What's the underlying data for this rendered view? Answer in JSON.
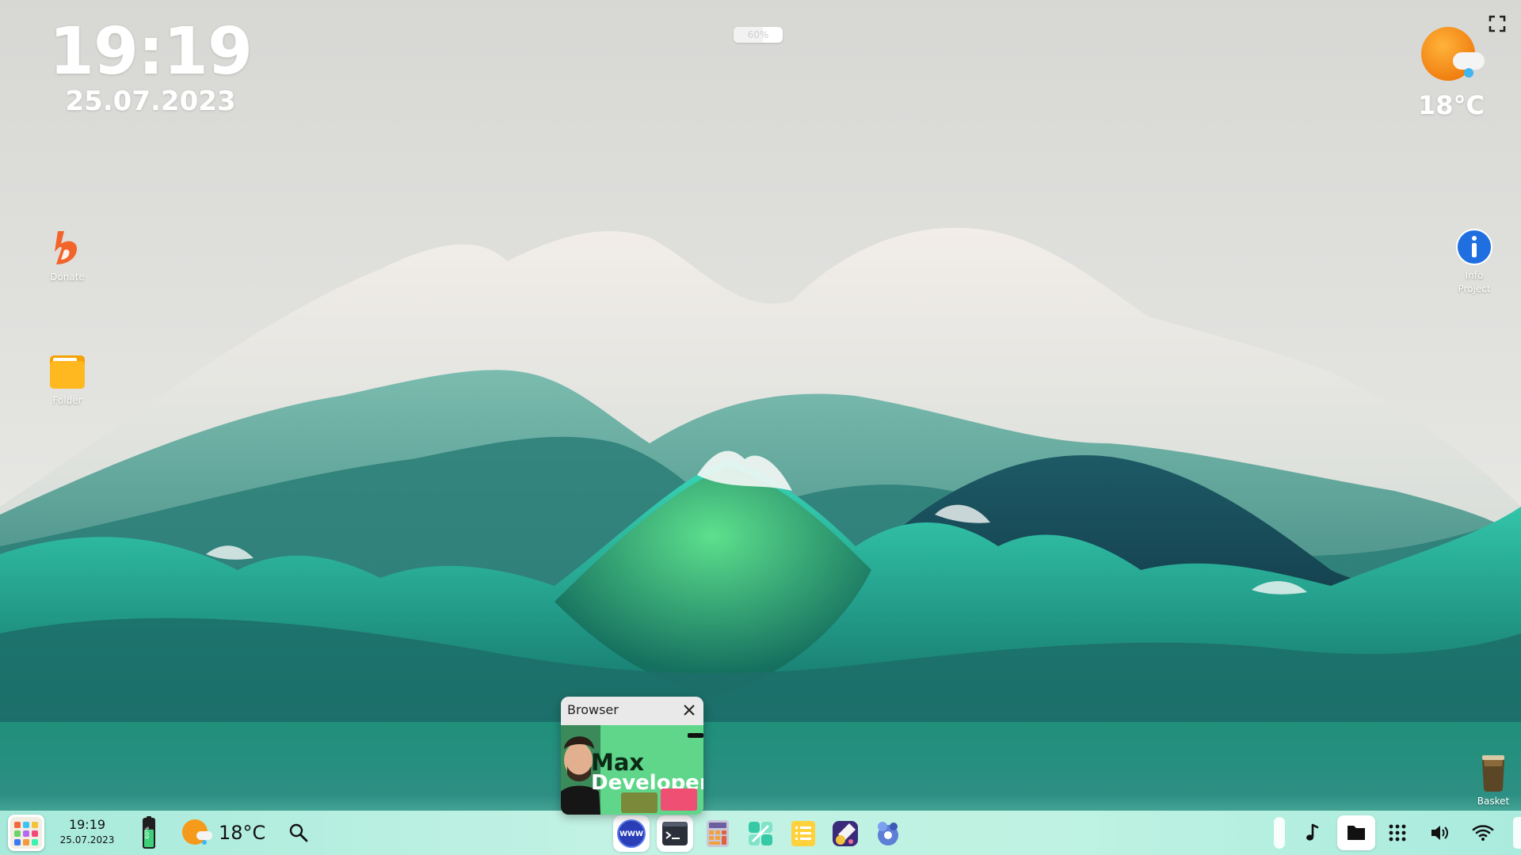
{
  "desktop": {
    "clock": {
      "time": "19:19",
      "date": "25.07.2023"
    },
    "battery_top": {
      "label": "60%",
      "level": 0.6
    },
    "weather": {
      "temp": "18°C",
      "icon": "sun-cloud-icon"
    },
    "icons": {
      "donate": {
        "label": "Donate",
        "icon": "donate-icon"
      },
      "folder": {
        "label": "Folder",
        "icon": "folder-icon"
      },
      "info": {
        "label": "Info\nProject",
        "icon": "info-icon"
      },
      "basket": {
        "label": "Basket",
        "icon": "basket-icon"
      }
    }
  },
  "browser_preview": {
    "title": "Browser",
    "thumbnail": {
      "line1": "Max",
      "line2": "Developer"
    }
  },
  "taskbar": {
    "start_icon": "start-menu-icon",
    "time": "19:19",
    "date": "25.07.2023",
    "battery": {
      "label": "60%",
      "level": 0.6
    },
    "weather": {
      "temp": "18°C",
      "icon": "sun-cloud-icon"
    },
    "search_icon": "search-icon",
    "dock": [
      {
        "name": "browser",
        "icon": "www-icon",
        "label": "WWW"
      },
      {
        "name": "terminal",
        "icon": "terminal-icon"
      },
      {
        "name": "calculator",
        "icon": "calculator-icon"
      },
      {
        "name": "app-store",
        "icon": "app-store-icon"
      },
      {
        "name": "notes",
        "icon": "notes-icon"
      },
      {
        "name": "paint",
        "icon": "paint-icon"
      },
      {
        "name": "settings",
        "icon": "settings-icon"
      }
    ],
    "tray": [
      "music-icon",
      "folder-icon",
      "apps-grid-icon",
      "volume-icon",
      "wifi-icon"
    ]
  },
  "colors": {
    "wave_green": "#2ecf7c",
    "wave_teal": "#1a8e84",
    "taskbar_bg": "#b8efe0",
    "sun_orange": "#f59a1a"
  }
}
